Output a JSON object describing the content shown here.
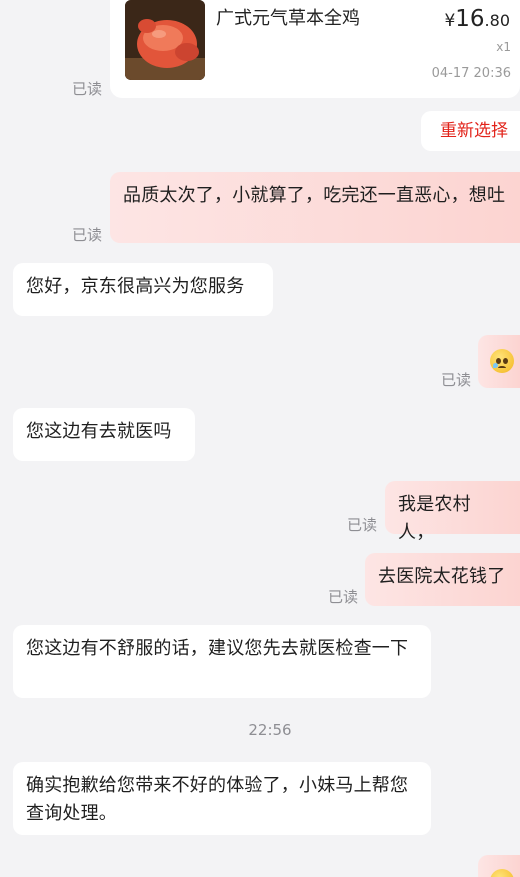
{
  "order": {
    "item_name": "广式元气草本全鸡",
    "price_currency": "¥",
    "price_integer": "16",
    "price_decimal": ".80",
    "quantity": "x1",
    "time": "04-17 20:36",
    "read_status": "已读"
  },
  "reselect_label": "重新选择",
  "messages": [
    {
      "from": "user",
      "text": "品质太次了，小就算了，吃完还一直恶心，想吐",
      "read": "已读"
    },
    {
      "from": "agent",
      "text": "您好，京东很高兴为您服务"
    },
    {
      "from": "user",
      "emoji": "crying-face",
      "read": "已读"
    },
    {
      "from": "agent",
      "text": "您这边有去就医吗"
    },
    {
      "from": "user",
      "text": "我是农村人，",
      "read": "已读"
    },
    {
      "from": "user",
      "text": "去医院太花钱了",
      "read": "已读"
    },
    {
      "from": "agent",
      "text": "您这边有不舒服的话，建议您先去就医检查一下"
    },
    {
      "from": "agent",
      "text": "确实抱歉给您带来不好的体验了，小妹马上帮您查询处理。"
    },
    {
      "from": "user",
      "emoji": "crying-face"
    }
  ],
  "timestamp": "22:56",
  "colors": {
    "page_bg": "#f3f3f5",
    "user_bubble": "#fcd8d5",
    "agent_bubble": "#ffffff",
    "accent_red": "#e2231a",
    "muted": "#8e8e93"
  }
}
